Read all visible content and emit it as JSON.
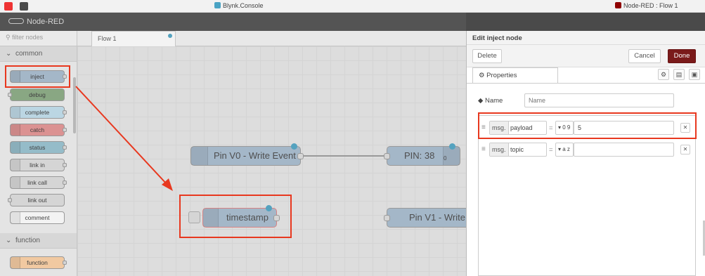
{
  "browser": {
    "tabs": [
      {
        "title": "Blynk.Console"
      },
      {
        "title": "Node-RED : Flow 1"
      }
    ]
  },
  "header": {
    "app_title": "Node-RED"
  },
  "palette": {
    "filter_placeholder": "filter nodes",
    "categories": [
      {
        "label": "common",
        "nodes": [
          "inject",
          "debug",
          "complete",
          "catch",
          "status",
          "link in",
          "link call",
          "link out",
          "comment"
        ]
      },
      {
        "label": "function",
        "nodes": [
          "function"
        ]
      }
    ]
  },
  "workspace": {
    "tabs": [
      {
        "label": "Flow 1"
      }
    ],
    "nodes": [
      {
        "label": "Pin V0 - Write Event",
        "color": "#a6bbcf"
      },
      {
        "label": "PIN: 38",
        "sub": "0",
        "color": "#a6bbcf"
      },
      {
        "label": "timestamp",
        "color": "#a6bbcf"
      },
      {
        "label": "Pin V1 - Write",
        "color": "#a6bbcf"
      }
    ]
  },
  "tray": {
    "title": "Edit inject node",
    "delete_label": "Delete",
    "cancel_label": "Cancel",
    "done_label": "Done",
    "properties_tab": "Properties",
    "name_label": "Name",
    "name_placeholder": "Name",
    "props": [
      {
        "prefix": "msg.",
        "key": "payload",
        "type_glyph": "0 9",
        "value": "5"
      },
      {
        "prefix": "msg.",
        "key": "topic",
        "type_glyph": "a z",
        "value": ""
      }
    ]
  },
  "colors": {
    "accent_red": "#e8381f",
    "done_button": "#7a1a1a",
    "status_dot": "#4aa3c4"
  }
}
